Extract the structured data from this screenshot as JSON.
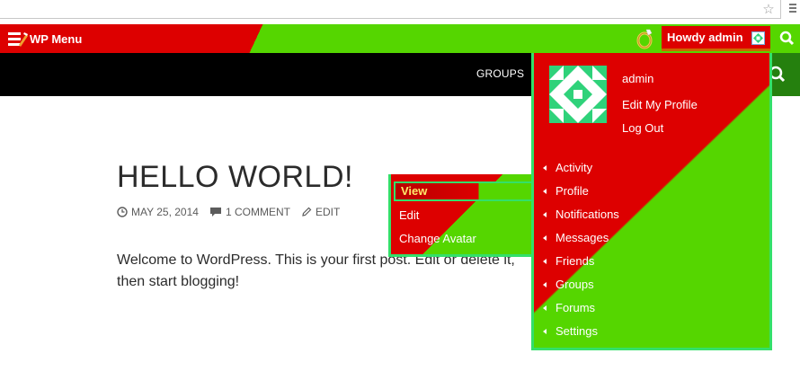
{
  "admin_bar": {
    "menu_label": "WP Menu",
    "howdy_label": "Howdy admin",
    "icons": [
      "wp-menu-icon",
      "ring-icon",
      "avatar-small",
      "search-icon"
    ]
  },
  "nav": {
    "groups_label": "GROUPS",
    "search_icon": "search-icon"
  },
  "post": {
    "title": "HELLO WORLD!",
    "date": "MAY 25, 2014",
    "comments": "1 COMMENT",
    "edit": "EDIT",
    "body": "Welcome to WordPress. This is your first post. Edit or delete it, then start blogging!"
  },
  "submenu": {
    "items": [
      "View",
      "Edit",
      "Change Avatar"
    ]
  },
  "account": {
    "username": "admin",
    "edit_profile": "Edit My Profile",
    "logout": "Log Out",
    "items": [
      "Activity",
      "Profile",
      "Notifications",
      "Messages",
      "Friends",
      "Groups",
      "Forums",
      "Settings"
    ]
  },
  "colors": {
    "red": "#dd0000",
    "green": "#55d600",
    "focus": "#33e06a",
    "nav": "#000000"
  }
}
